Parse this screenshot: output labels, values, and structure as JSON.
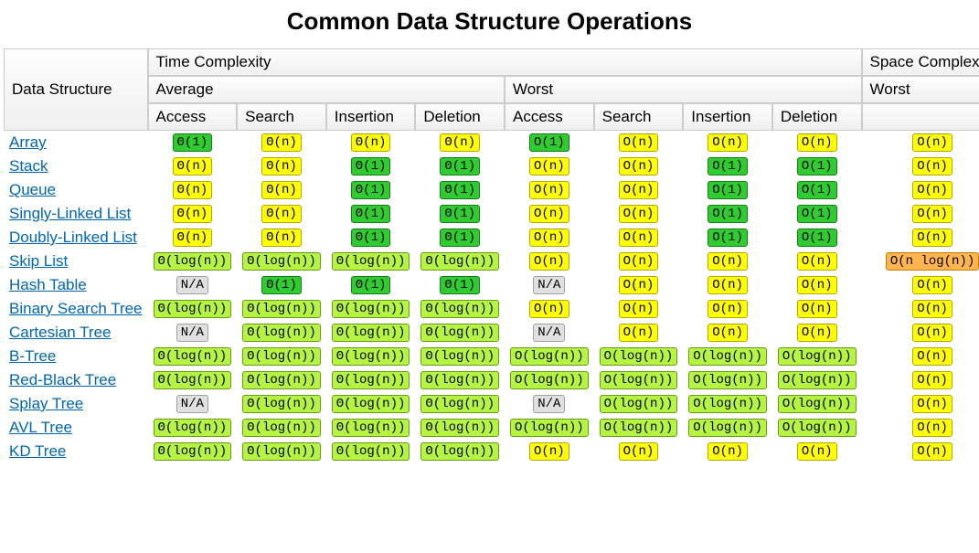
{
  "title": "Common Data Structure Operations",
  "headers": {
    "ds": "Data Structure",
    "time": "Time Complexity",
    "space": "Space Complexity",
    "avg": "Average",
    "worst": "Worst",
    "ops": [
      "Access",
      "Search",
      "Insertion",
      "Deletion"
    ]
  },
  "complexity_colors": {
    "Θ(1)": "c-green",
    "O(1)": "c-green",
    "Θ(log(n))": "c-yg",
    "O(log(n))": "c-yg",
    "Θ(n)": "c-yellow",
    "O(n)": "c-yellow",
    "O(n log(n))": "c-orange",
    "N/A": "c-gray"
  },
  "chart_data": {
    "type": "table",
    "title": "Common Data Structure Operations",
    "columns": [
      "Data Structure",
      "Avg Access",
      "Avg Search",
      "Avg Insertion",
      "Avg Deletion",
      "Worst Access",
      "Worst Search",
      "Worst Insertion",
      "Worst Deletion",
      "Space Worst"
    ],
    "rows": [
      {
        "name": "Array",
        "avg": [
          "Θ(1)",
          "Θ(n)",
          "Θ(n)",
          "Θ(n)"
        ],
        "worst": [
          "O(1)",
          "O(n)",
          "O(n)",
          "O(n)"
        ],
        "space": "O(n)"
      },
      {
        "name": "Stack",
        "avg": [
          "Θ(n)",
          "Θ(n)",
          "Θ(1)",
          "Θ(1)"
        ],
        "worst": [
          "O(n)",
          "O(n)",
          "O(1)",
          "O(1)"
        ],
        "space": "O(n)"
      },
      {
        "name": "Queue",
        "avg": [
          "Θ(n)",
          "Θ(n)",
          "Θ(1)",
          "Θ(1)"
        ],
        "worst": [
          "O(n)",
          "O(n)",
          "O(1)",
          "O(1)"
        ],
        "space": "O(n)"
      },
      {
        "name": "Singly-Linked List",
        "avg": [
          "Θ(n)",
          "Θ(n)",
          "Θ(1)",
          "Θ(1)"
        ],
        "worst": [
          "O(n)",
          "O(n)",
          "O(1)",
          "O(1)"
        ],
        "space": "O(n)"
      },
      {
        "name": "Doubly-Linked List",
        "avg": [
          "Θ(n)",
          "Θ(n)",
          "Θ(1)",
          "Θ(1)"
        ],
        "worst": [
          "O(n)",
          "O(n)",
          "O(1)",
          "O(1)"
        ],
        "space": "O(n)"
      },
      {
        "name": "Skip List",
        "avg": [
          "Θ(log(n))",
          "Θ(log(n))",
          "Θ(log(n))",
          "Θ(log(n))"
        ],
        "worst": [
          "O(n)",
          "O(n)",
          "O(n)",
          "O(n)"
        ],
        "space": "O(n log(n))"
      },
      {
        "name": "Hash Table",
        "avg": [
          "N/A",
          "Θ(1)",
          "Θ(1)",
          "Θ(1)"
        ],
        "worst": [
          "N/A",
          "O(n)",
          "O(n)",
          "O(n)"
        ],
        "space": "O(n)"
      },
      {
        "name": "Binary Search Tree",
        "avg": [
          "Θ(log(n))",
          "Θ(log(n))",
          "Θ(log(n))",
          "Θ(log(n))"
        ],
        "worst": [
          "O(n)",
          "O(n)",
          "O(n)",
          "O(n)"
        ],
        "space": "O(n)"
      },
      {
        "name": "Cartesian Tree",
        "avg": [
          "N/A",
          "Θ(log(n))",
          "Θ(log(n))",
          "Θ(log(n))"
        ],
        "worst": [
          "N/A",
          "O(n)",
          "O(n)",
          "O(n)"
        ],
        "space": "O(n)"
      },
      {
        "name": "B-Tree",
        "avg": [
          "Θ(log(n))",
          "Θ(log(n))",
          "Θ(log(n))",
          "Θ(log(n))"
        ],
        "worst": [
          "O(log(n))",
          "O(log(n))",
          "O(log(n))",
          "O(log(n))"
        ],
        "space": "O(n)"
      },
      {
        "name": "Red-Black Tree",
        "avg": [
          "Θ(log(n))",
          "Θ(log(n))",
          "Θ(log(n))",
          "Θ(log(n))"
        ],
        "worst": [
          "O(log(n))",
          "O(log(n))",
          "O(log(n))",
          "O(log(n))"
        ],
        "space": "O(n)"
      },
      {
        "name": "Splay Tree",
        "avg": [
          "N/A",
          "Θ(log(n))",
          "Θ(log(n))",
          "Θ(log(n))"
        ],
        "worst": [
          "N/A",
          "O(log(n))",
          "O(log(n))",
          "O(log(n))"
        ],
        "space": "O(n)"
      },
      {
        "name": "AVL Tree",
        "avg": [
          "Θ(log(n))",
          "Θ(log(n))",
          "Θ(log(n))",
          "Θ(log(n))"
        ],
        "worst": [
          "O(log(n))",
          "O(log(n))",
          "O(log(n))",
          "O(log(n))"
        ],
        "space": "O(n)"
      },
      {
        "name": "KD Tree",
        "avg": [
          "Θ(log(n))",
          "Θ(log(n))",
          "Θ(log(n))",
          "Θ(log(n))"
        ],
        "worst": [
          "O(n)",
          "O(n)",
          "O(n)",
          "O(n)"
        ],
        "space": "O(n)"
      }
    ]
  }
}
